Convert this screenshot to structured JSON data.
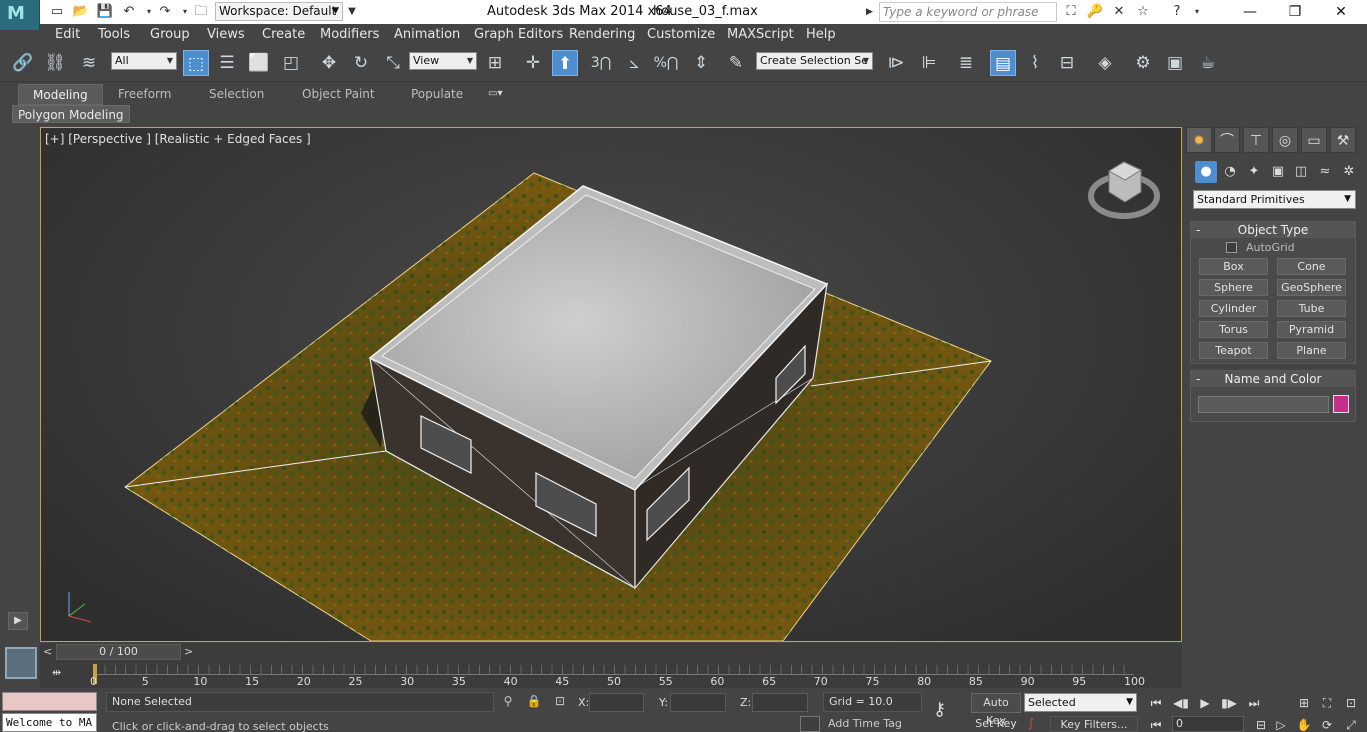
{
  "titlebar": {
    "workspace": "Workspace: Default",
    "app_title": "Autodesk 3ds Max  2014 x64",
    "file_title": "house_03_f.max",
    "search_placeholder": "Type a keyword or phrase"
  },
  "menu": [
    "Edit",
    "Tools",
    "Group",
    "Views",
    "Create",
    "Modifiers",
    "Animation",
    "Graph Editors",
    "Rendering",
    "Customize",
    "MAXScript",
    "Help"
  ],
  "toolbar": {
    "selection_filter": "All",
    "ref_coord": "View",
    "named_selection": "Create Selection Se",
    "snap_angle_label": "3",
    "percent_snap_label": "%"
  },
  "ribbon": {
    "tabs": [
      "Modeling",
      "Freeform",
      "Selection",
      "Object Paint",
      "Populate"
    ],
    "active_tab": "Modeling",
    "panel": "Polygon Modeling"
  },
  "viewport": {
    "label": "[+] [Perspective ] [Realistic + Edged Faces ]",
    "accent_color": "#c8a23c"
  },
  "command_panel": {
    "category": "Standard Primitives",
    "object_type_title": "Object Type",
    "autogrid": "AutoGrid",
    "buttons": [
      "Box",
      "Cone",
      "Sphere",
      "GeoSphere",
      "Cylinder",
      "Tube",
      "Torus",
      "Pyramid",
      "Teapot",
      "Plane"
    ],
    "name_color_title": "Name and Color",
    "object_color": "#c4308b"
  },
  "timeline": {
    "frame_indicator": "0 / 100",
    "ticks": [
      "0",
      "5",
      "10",
      "15",
      "20",
      "25",
      "30",
      "35",
      "40",
      "45",
      "50",
      "55",
      "60",
      "65",
      "70",
      "75",
      "80",
      "85",
      "90",
      "95",
      "100"
    ]
  },
  "status": {
    "maxscript_welcome": "Welcome to MA",
    "selection": "None Selected",
    "prompt": "Click or click-and-drag to select objects",
    "x_label": "X:",
    "y_label": "Y:",
    "z_label": "Z:",
    "grid": "Grid = 10.0",
    "add_time_tag": "Add Time Tag",
    "auto_key": "Auto Key",
    "set_key": "Set Key",
    "key_mode": "Selected",
    "key_filters": "Key Filters...",
    "current_frame": "0"
  }
}
